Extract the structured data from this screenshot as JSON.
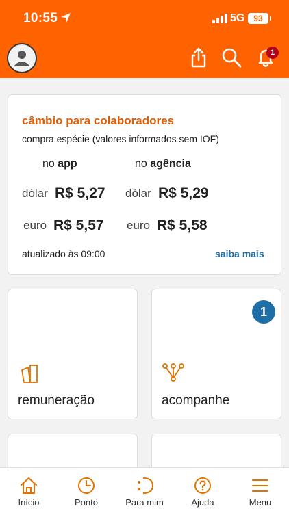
{
  "status_bar": {
    "time": "10:55",
    "network": "5G",
    "battery": "93"
  },
  "header": {
    "avatar_icon": "person-icon",
    "share_icon": "share-icon",
    "search_icon": "search-icon",
    "bell_icon": "bell-icon",
    "notification_count": "1",
    "brand_color": "#ff6200"
  },
  "cambio": {
    "title": "câmbio para colaboradores",
    "subtitle": "compra espécie (valores informados sem IOF)",
    "col_app_prefix": "no",
    "col_app": "app",
    "col_agencia_prefix": "no",
    "col_agencia": "agência",
    "rows": [
      {
        "label_app": "dólar",
        "value_app": "R$ 5,27",
        "label_ag": "dólar",
        "value_ag": "R$ 5,29"
      },
      {
        "label_app": "euro",
        "value_app": "R$ 5,57",
        "label_ag": "euro",
        "value_ag": "R$ 5,58"
      }
    ],
    "updated": "atualizado às 09:00",
    "saiba_mais": "saiba mais"
  },
  "tiles": [
    {
      "label": "remuneração",
      "icon": "cards-icon",
      "badge": ""
    },
    {
      "label": "acompanhe",
      "icon": "nodes-icon",
      "badge": "1"
    }
  ],
  "bottom_nav": [
    {
      "label": "Início",
      "icon": "home-icon"
    },
    {
      "label": "Ponto",
      "icon": "clock-icon"
    },
    {
      "label": "Para mim",
      "icon": "para-mim-icon"
    },
    {
      "label": "Ajuda",
      "icon": "help-icon"
    },
    {
      "label": "Menu",
      "icon": "menu-icon"
    }
  ]
}
